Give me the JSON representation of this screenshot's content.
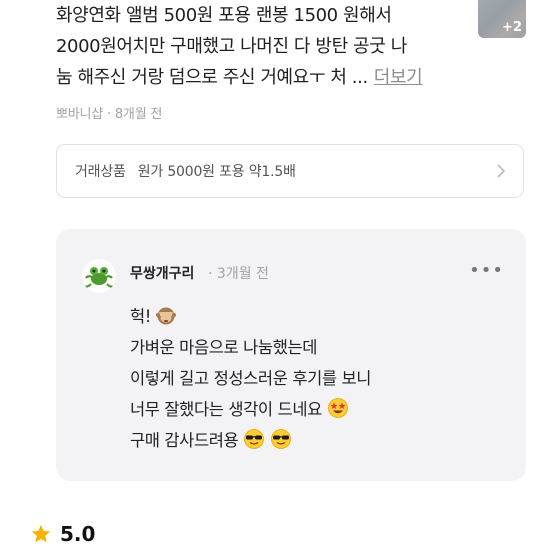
{
  "review": {
    "lines": [
      "화양연화 앨범 500원 포용 랜봉 1500 원해서",
      "2000원어치만 구매했고 나머진 다 방탄 공굿 나",
      "눔 해주신 거랑 덤으로 주신 거예요ㅜ 처 ..."
    ],
    "more_label": "더보기",
    "thumb_count": "+2",
    "author": "뽀바니샵",
    "separator": "·",
    "time": "8개월 전"
  },
  "trade": {
    "label": "거래상품",
    "value": "원가 5000원 포용 약1.5배"
  },
  "reply": {
    "author": "무쌍개구리",
    "separator": "·",
    "time": "3개월 전",
    "menu": "•••",
    "lines": [
      "헉!",
      "가벼운 마음으로 나눔했는데",
      "이렇게 길고 정성스러운 후기를 보니",
      "너무 잘했다는 생각이 드네요",
      "구매 감사드려용"
    ]
  },
  "rating": {
    "value": "5.0",
    "star_color": "#f5b400"
  }
}
